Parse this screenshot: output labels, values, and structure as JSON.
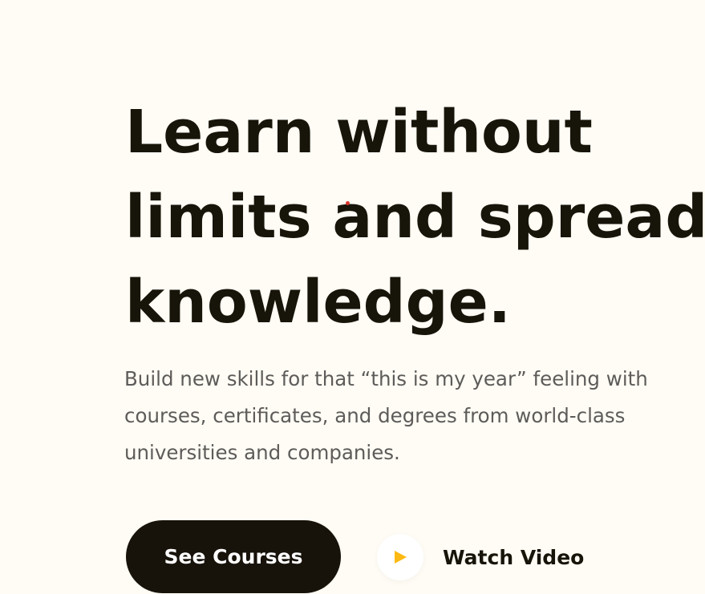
{
  "hero": {
    "title_lines": [
      "Learn without",
      "limits and spread",
      "knowledge."
    ],
    "subtitle": "Build new skills for that “this is my year” feeling with courses, certificates, and degrees from world-class universities and companies.",
    "primary_cta": "See Courses",
    "secondary_cta": "Watch Video",
    "play_icon": "play-icon"
  },
  "colors": {
    "background": "#FEFCF4",
    "text_dark": "#17140A",
    "text_muted": "#5E5C5A",
    "button_dark": "#17120A",
    "accent_play": "#FDB913"
  }
}
